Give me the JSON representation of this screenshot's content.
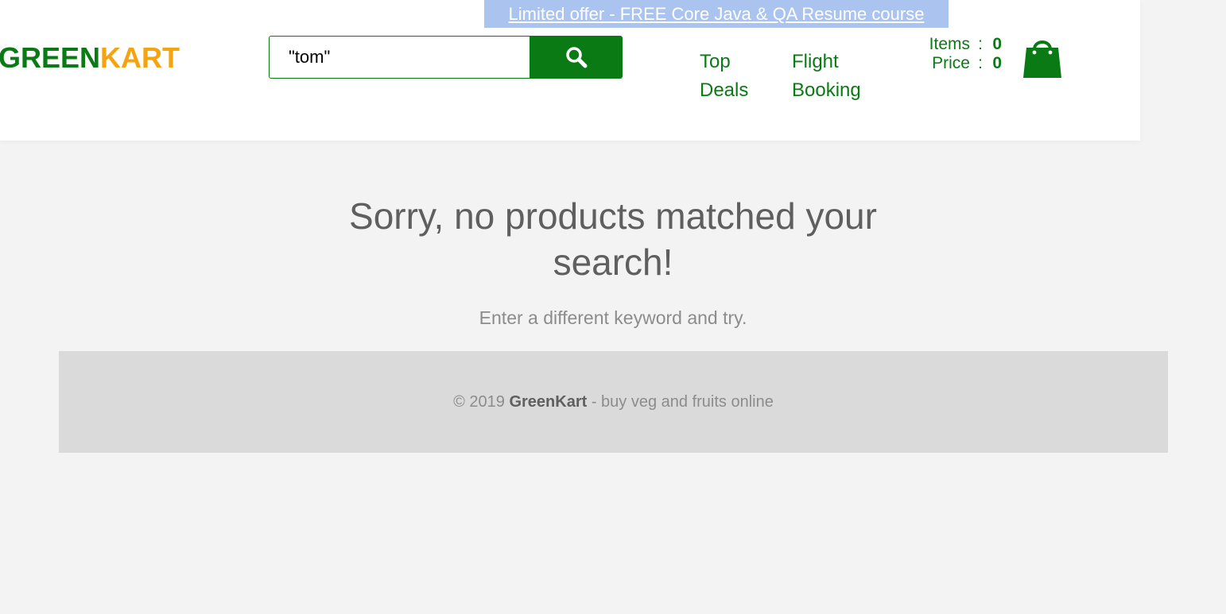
{
  "promo": {
    "text": "Limited offer - FREE Core Java & QA Resume course"
  },
  "logo": {
    "part1": "GREEN",
    "part2": "KART"
  },
  "search": {
    "value": "\"tom\"",
    "button_icon": "search-icon"
  },
  "nav": {
    "top_deals": "Top Deals",
    "flight_booking": "Flight Booking"
  },
  "cart": {
    "items_label": "Items",
    "items_value": "0",
    "price_label": "Price",
    "price_value": "0",
    "separator": ":",
    "icon": "shopping-bag-icon"
  },
  "empty_state": {
    "title": "Sorry, no products matched your search!",
    "subtitle": "Enter a different keyword and try."
  },
  "footer": {
    "prefix": "© 2019",
    "brand": "GreenKart",
    "suffix": "- buy veg and fruits online"
  },
  "colors": {
    "brand_green": "#0a7b14",
    "brand_orange": "#f5a30f",
    "promo_bg": "#abc4ef",
    "page_bg": "#f3f3f3",
    "footer_bg": "#dadada"
  }
}
